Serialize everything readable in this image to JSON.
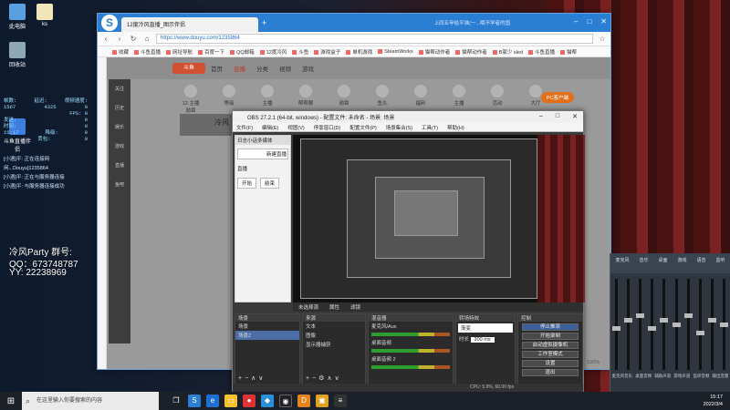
{
  "desktop": {
    "icons": [
      {
        "label": "此电脑"
      },
      {
        "label": "ks"
      },
      {
        "label": "回收站"
      },
      {
        "label": "斗鱼直播伴侣"
      }
    ],
    "stats": {
      "row1": [
        "帧数:",
        "延迟:",
        "视频速度:"
      ],
      "row2": [
        "1567",
        "4325",
        "0"
      ],
      "fps": "FPS: 0",
      "l1": "发送:",
      "l1v": "0",
      "l2": "时间:",
      "l2v": "0",
      "l3": "15:17",
      "l3b": "降级:",
      "l3v": "0",
      "l4b": "丢包:",
      "l4v": "0"
    },
    "log": [
      "[小酒]平: 正在连接网",
      "闲...Douyu]1235864",
      "[小酒]平: 正在与服务器连接",
      "[小酒]平: 与服务器连接成功"
    ],
    "overlay": {
      "title": "冷风Party 群号:",
      "qq": "QQ：673748787",
      "yy": "YY:  22238969"
    }
  },
  "browser": {
    "tab_title": "12度冷风直播_图示伴侣",
    "url": "https://www.douyu.com/1235864",
    "search_hint": "上四五甲给平准(一...哦不学者的国",
    "bookmarks": [
      "收藏",
      "斗鱼直播",
      "网址导航",
      "百度一下",
      "QQ邮箱",
      "12度冷风",
      "斗鱼",
      "游戏盒子",
      "单机游戏",
      "SteamWorks",
      "猫帮动作者",
      "猫帮动作者",
      "B家少 sled",
      "斗鱼直播",
      "猫帮"
    ],
    "douyu": {
      "logo": "斗鱼",
      "nav": [
        "首页",
        "直播",
        "分类",
        "视频",
        "游戏"
      ],
      "left_menu": [
        "关注",
        "历史",
        "娱乐",
        "游戏",
        "直播",
        "鱼吧"
      ],
      "tags": [
        "12 主播勋章",
        "等级",
        "主播",
        "帮帮聊",
        "勋章",
        "鱼丸",
        "福利",
        "主播",
        "活动",
        "大厅"
      ],
      "anchor": "冷风",
      "pc_button": "PC客户端",
      "zoom": "100%"
    }
  },
  "obs": {
    "title": "OBS 27.2.1 (64-bit, windows) - 配置文件: 未命名 - 场景: 场景",
    "menu": [
      "文件(F)",
      "编辑(E)",
      "视图(V)",
      "停靠窗口(D)",
      "配置文件(P)",
      "场景集合(S)",
      "工具(T)",
      "帮助(H)"
    ],
    "left_panel_title": "日志小话多媒体",
    "left_panel_items": [
      "新建直播",
      "直播",
      "开始",
      "结束"
    ],
    "source_bar": [
      "未选择源",
      "属性",
      "滤镜"
    ],
    "scenes": {
      "header": "场景",
      "items": [
        "场景",
        "场景2"
      ]
    },
    "sources": {
      "header": "来源",
      "items": [
        "文本",
        "图像",
        "显示器捕获"
      ]
    },
    "mixer": {
      "header": "混音器",
      "items": [
        "麦克风/Aux",
        "桌面音频",
        "桌面音频 2"
      ]
    },
    "transitions": {
      "header": "转场特效",
      "type": "渐变",
      "duration_label": "时长",
      "duration": "300 ms"
    },
    "controls": {
      "header": "控制",
      "buttons": [
        "停止推流",
        "开始录制",
        "启动虚拟摄像机",
        "工作室模式",
        "设置",
        "退出"
      ]
    },
    "status": "CPU: 5.9%, 60.00 fps"
  },
  "audio_mixer": {
    "header": [
      "麦克风",
      "音乐",
      "桌面",
      "游戏",
      "语音",
      "监听"
    ],
    "labels": [
      "麦克风音乐",
      "桌面音频",
      "辅助声道",
      "游戏声道",
      "监听音频",
      "输出音量"
    ],
    "fader_levels": [
      0.45,
      0.55,
      0.6,
      0.45,
      0.55,
      0.5,
      0.6,
      0.4,
      0.55,
      0.5
    ]
  },
  "taskbar": {
    "search_placeholder": "在这里输入你要搜索的内容",
    "time": "15:17",
    "date": "2022/3/4"
  }
}
